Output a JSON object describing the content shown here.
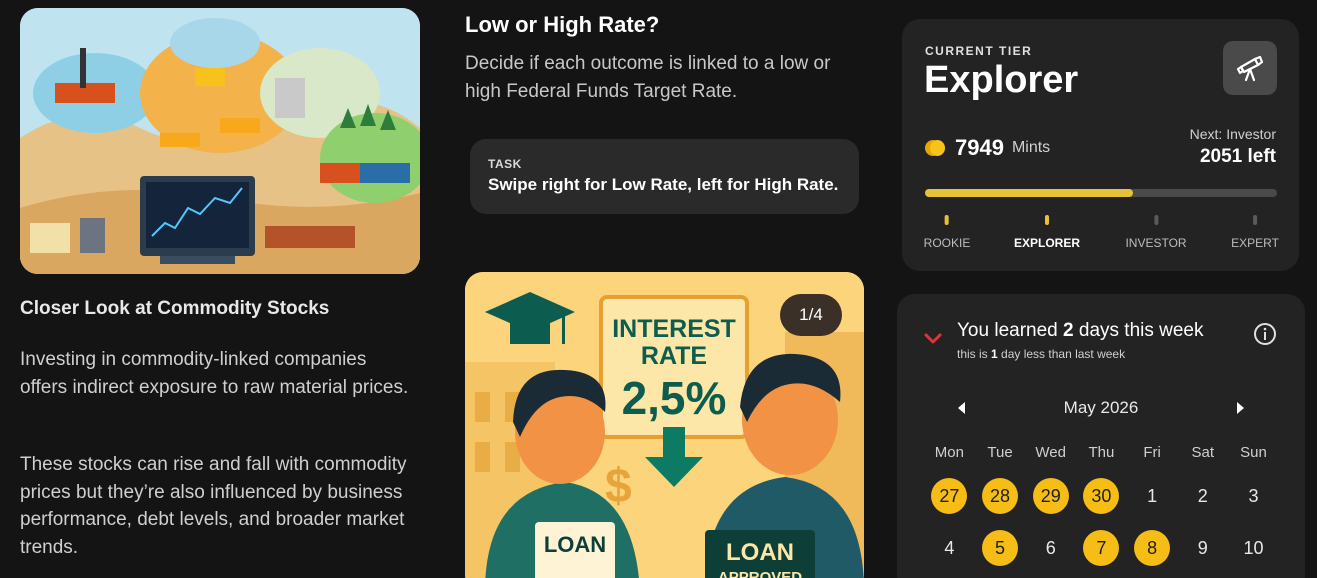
{
  "article": {
    "title": "Closer Look at Commodity Stocks",
    "paragraph1": "Investing in commodity-linked companies offers indirect exposure to raw material prices.",
    "paragraph2": "These stocks can rise and fall with commodity prices but they’re also influenced by business performance, debt levels, and broader market trends."
  },
  "quiz": {
    "title": "Low or High Rate?",
    "description": "Decide if each outcome is linked to a low or high Federal Funds Target Rate.",
    "task_label": "TASK",
    "task_text": "Swipe right for Low Rate, left for High Rate.",
    "card_counter": "1/4",
    "card_sign_line1": "INTEREST",
    "card_sign_line2": "RATE",
    "card_rate": "2,5%",
    "card_loan_left": "LOAN",
    "card_loan_right": "LOAN",
    "card_loan_right_sub": "APPROVED"
  },
  "tier": {
    "label": "CURRENT TIER",
    "name": "Explorer",
    "icon": "telescope-icon",
    "mints_value": "7949",
    "mints_unit": "Mints",
    "next_label": "Next: Investor",
    "left_value": "2051 left",
    "progress": 0.59,
    "accent": "#e5c236",
    "steps": [
      {
        "label": "ROOKIE",
        "state": "done"
      },
      {
        "label": "EXPLORER",
        "state": "current"
      },
      {
        "label": "INVESTOR",
        "state": "todo"
      },
      {
        "label": "EXPERT",
        "state": "todo"
      }
    ]
  },
  "streak": {
    "learned_prefix": "You learned ",
    "learned_count": "2",
    "learned_suffix": " days this week",
    "sub_prefix": "this is ",
    "sub_count": "1",
    "sub_suffix": " day less than last week",
    "trend_color": "#e0333a",
    "month": "May 2026",
    "weekdays": [
      "Mon",
      "Tue",
      "Wed",
      "Thu",
      "Fri",
      "Sat",
      "Sun"
    ],
    "days": [
      {
        "d": "27",
        "hl": true
      },
      {
        "d": "28",
        "hl": true
      },
      {
        "d": "29",
        "hl": true
      },
      {
        "d": "30",
        "hl": true
      },
      {
        "d": "1",
        "hl": false
      },
      {
        "d": "2",
        "hl": false
      },
      {
        "d": "3",
        "hl": false
      },
      {
        "d": "4",
        "hl": false
      },
      {
        "d": "5",
        "hl": true
      },
      {
        "d": "6",
        "hl": false
      },
      {
        "d": "7",
        "hl": true
      },
      {
        "d": "8",
        "hl": true
      },
      {
        "d": "9",
        "hl": false
      },
      {
        "d": "10",
        "hl": false
      }
    ],
    "highlight_color": "#f5bd15"
  }
}
